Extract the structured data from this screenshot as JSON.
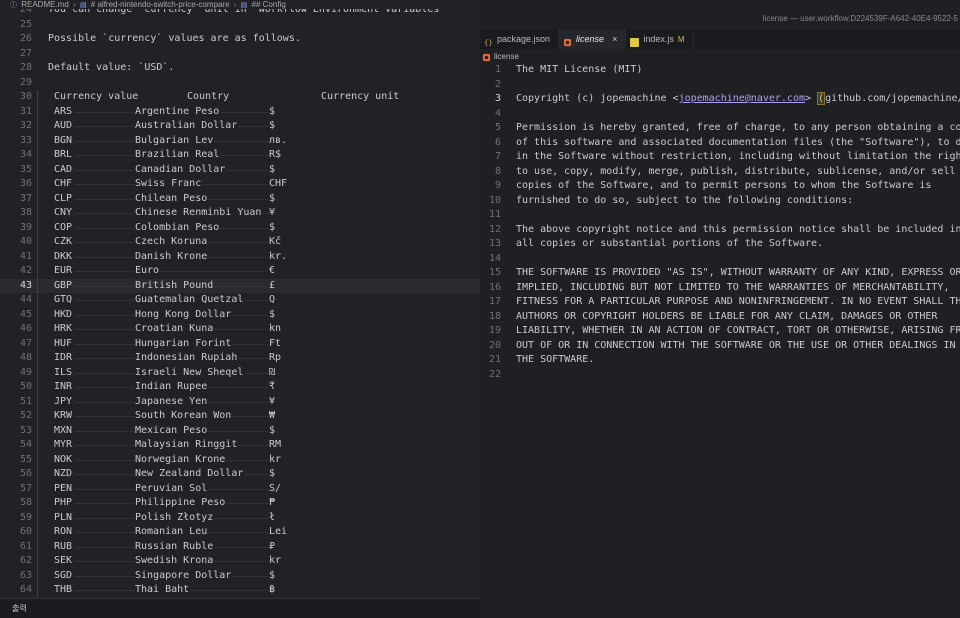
{
  "left": {
    "breadcrumb": [
      "README.md",
      "# alfred-nintendo-switch-price-compare",
      "## Config"
    ],
    "lines": [
      {
        "n": "24",
        "t": "You can change `currency` unit in `Workflow Environment Variables`"
      },
      {
        "n": "25",
        "t": ""
      },
      {
        "n": "26",
        "t": "Possible `currency` values are as follows."
      },
      {
        "n": "27",
        "t": ""
      },
      {
        "n": "28",
        "t": "Default value: `USD`."
      },
      {
        "n": "29",
        "t": ""
      }
    ],
    "table_header": {
      "n": "30",
      "c1": "Currency value",
      "c2": "Country",
      "c3": "Currency unit"
    },
    "rows": [
      {
        "n": "31",
        "code": "ARS",
        "country": "Argentine Peso",
        "unit": "$"
      },
      {
        "n": "32",
        "code": "AUD",
        "country": "Australian Dollar",
        "unit": "$"
      },
      {
        "n": "33",
        "code": "BGN",
        "country": "Bulgarian Lev",
        "unit": "лв."
      },
      {
        "n": "34",
        "code": "BRL",
        "country": "Brazilian Real",
        "unit": "R$"
      },
      {
        "n": "35",
        "code": "CAD",
        "country": "Canadian Dollar",
        "unit": "$"
      },
      {
        "n": "36",
        "code": "CHF",
        "country": "Swiss Franc",
        "unit": "CHF"
      },
      {
        "n": "37",
        "code": "CLP",
        "country": "Chilean Peso",
        "unit": "$"
      },
      {
        "n": "38",
        "code": "CNY",
        "country": "Chinese Renminbi Yuan",
        "unit": "¥"
      },
      {
        "n": "39",
        "code": "COP",
        "country": "Colombian Peso",
        "unit": "$"
      },
      {
        "n": "40",
        "code": "CZK",
        "country": "Czech Koruna",
        "unit": "Kč"
      },
      {
        "n": "41",
        "code": "DKK",
        "country": "Danish Krone",
        "unit": "kr."
      },
      {
        "n": "42",
        "code": "EUR",
        "country": "Euro",
        "unit": "€"
      },
      {
        "n": "43",
        "code": "GBP",
        "country": "British Pound",
        "unit": "£"
      },
      {
        "n": "44",
        "code": "GTQ",
        "country": "Guatemalan Quetzal",
        "unit": "Q"
      },
      {
        "n": "45",
        "code": "HKD",
        "country": "Hong Kong Dollar",
        "unit": "$"
      },
      {
        "n": "46",
        "code": "HRK",
        "country": "Croatian Kuna",
        "unit": "kn"
      },
      {
        "n": "47",
        "code": "HUF",
        "country": "Hungarian Forint",
        "unit": "Ft"
      },
      {
        "n": "48",
        "code": "IDR",
        "country": "Indonesian Rupiah",
        "unit": "Rp"
      },
      {
        "n": "49",
        "code": "ILS",
        "country": "Israeli New Sheqel",
        "unit": "₪"
      },
      {
        "n": "50",
        "code": "INR",
        "country": "Indian Rupee",
        "unit": "₹"
      },
      {
        "n": "51",
        "code": "JPY",
        "country": "Japanese Yen",
        "unit": "¥"
      },
      {
        "n": "52",
        "code": "KRW",
        "country": "South Korean Won",
        "unit": "₩"
      },
      {
        "n": "53",
        "code": "MXN",
        "country": "Mexican Peso",
        "unit": "$"
      },
      {
        "n": "54",
        "code": "MYR",
        "country": "Malaysian Ringgit",
        "unit": "RM"
      },
      {
        "n": "55",
        "code": "NOK",
        "country": "Norwegian Krone",
        "unit": "kr"
      },
      {
        "n": "56",
        "code": "NZD",
        "country": "New Zealand Dollar",
        "unit": "$"
      },
      {
        "n": "57",
        "code": "PEN",
        "country": "Peruvian Sol",
        "unit": "S/"
      },
      {
        "n": "58",
        "code": "PHP",
        "country": "Philippine Peso",
        "unit": "₱"
      },
      {
        "n": "59",
        "code": "PLN",
        "country": "Polish Złotyz",
        "unit": "ł"
      },
      {
        "n": "60",
        "code": "RON",
        "country": "Romanian Leu",
        "unit": "Lei"
      },
      {
        "n": "61",
        "code": "RUB",
        "country": "Russian Ruble",
        "unit": "₽"
      },
      {
        "n": "62",
        "code": "SEK",
        "country": "Swedish Krona",
        "unit": "kr"
      },
      {
        "n": "63",
        "code": "SGD",
        "country": "Singapore Dollar",
        "unit": "$"
      },
      {
        "n": "64",
        "code": "THB",
        "country": "Thai Baht",
        "unit": "฿"
      }
    ],
    "current_line": "43",
    "panel_label": "출력"
  },
  "right": {
    "window_title": "license — user.workflow.D224539F-A642-40E4-9522-5",
    "tabs": [
      {
        "label": "package.json",
        "icon": "json-icon",
        "active": false,
        "close": "",
        "modified": ""
      },
      {
        "label": "license",
        "icon": "license-icon",
        "active": true,
        "close": "×",
        "modified": ""
      },
      {
        "label": "index.js",
        "icon": "js-icon",
        "active": false,
        "close": "",
        "modified": "M"
      }
    ],
    "breadcrumb": "license",
    "current_line": "3",
    "lines": [
      {
        "n": "1",
        "t": "The MIT License (MIT)"
      },
      {
        "n": "2",
        "t": ""
      },
      {
        "n": "3",
        "t": "Copyright (c) jopemachine <",
        "link": "jopemachine@naver.com",
        "after": "> ",
        "hl": "(",
        "tail": "github.com/jopemachine/alf"
      },
      {
        "n": "4",
        "t": ""
      },
      {
        "n": "5",
        "t": "Permission is hereby granted, free of charge, to any person obtaining a copy"
      },
      {
        "n": "6",
        "t": "of this software and associated documentation files (the \"Software\"), to deal"
      },
      {
        "n": "7",
        "t": "in the Software without restriction, including without limitation the rights"
      },
      {
        "n": "8",
        "t": "to use, copy, modify, merge, publish, distribute, sublicense, and/or sell"
      },
      {
        "n": "9",
        "t": "copies of the Software, and to permit persons to whom the Software is"
      },
      {
        "n": "10",
        "t": "furnished to do so, subject to the following conditions:"
      },
      {
        "n": "11",
        "t": ""
      },
      {
        "n": "12",
        "t": "The above copyright notice and this permission notice shall be included in"
      },
      {
        "n": "13",
        "t": "all copies or substantial portions of the Software."
      },
      {
        "n": "14",
        "t": ""
      },
      {
        "n": "15",
        "t": "THE SOFTWARE IS PROVIDED \"AS IS\", WITHOUT WARRANTY OF ANY KIND, EXPRESS OR"
      },
      {
        "n": "16",
        "t": "IMPLIED, INCLUDING BUT NOT LIMITED TO THE WARRANTIES OF MERCHANTABILITY,"
      },
      {
        "n": "17",
        "t": "FITNESS FOR A PARTICULAR PURPOSE AND NONINFRINGEMENT. IN NO EVENT SHALL THE"
      },
      {
        "n": "18",
        "t": "AUTHORS OR COPYRIGHT HOLDERS BE LIABLE FOR ANY CLAIM, DAMAGES OR OTHER"
      },
      {
        "n": "19",
        "t": "LIABILITY, WHETHER IN AN ACTION OF CONTRACT, TORT OR OTHERWISE, ARISING FROM,"
      },
      {
        "n": "20",
        "t": "OUT OF OR IN CONNECTION WITH THE SOFTWARE OR THE USE OR OTHER DEALINGS IN"
      },
      {
        "n": "21",
        "t": "THE SOFTWARE."
      },
      {
        "n": "22",
        "t": ""
      }
    ]
  },
  "colors": {
    "link": "#b39df3",
    "modified": "#d7b36a",
    "license_icon": "#e06c3c",
    "active_tab": "#25272b"
  }
}
